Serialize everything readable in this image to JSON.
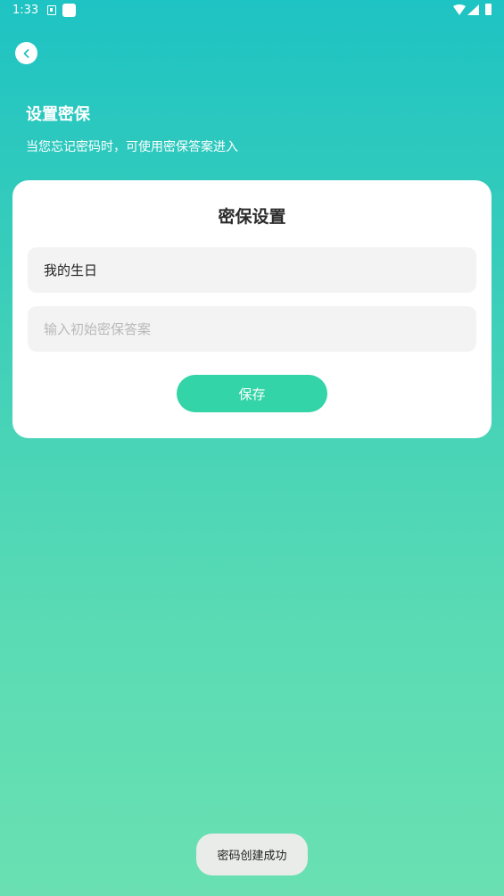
{
  "status_bar": {
    "time": "1:33",
    "icons": [
      "a-notification-icon",
      "square-notification-icon",
      "wifi-icon",
      "signal-icon",
      "battery-icon"
    ]
  },
  "header": {
    "back_icon": "chevron-left-icon",
    "title": "设置密保",
    "subtitle": "当您忘记密码时，可使用密保答案进入"
  },
  "card": {
    "title": "密保设置",
    "question_value": "我的生日",
    "answer_value": "",
    "answer_placeholder": "输入初始密保答案",
    "save_label": "保存"
  },
  "toast": {
    "message": "密码创建成功"
  },
  "colors": {
    "gradient_top": "#1ec3c3",
    "gradient_bottom": "#6ae0b2",
    "accent": "#33d4a7",
    "card_bg": "#ffffff",
    "field_bg": "#f3f3f3"
  }
}
